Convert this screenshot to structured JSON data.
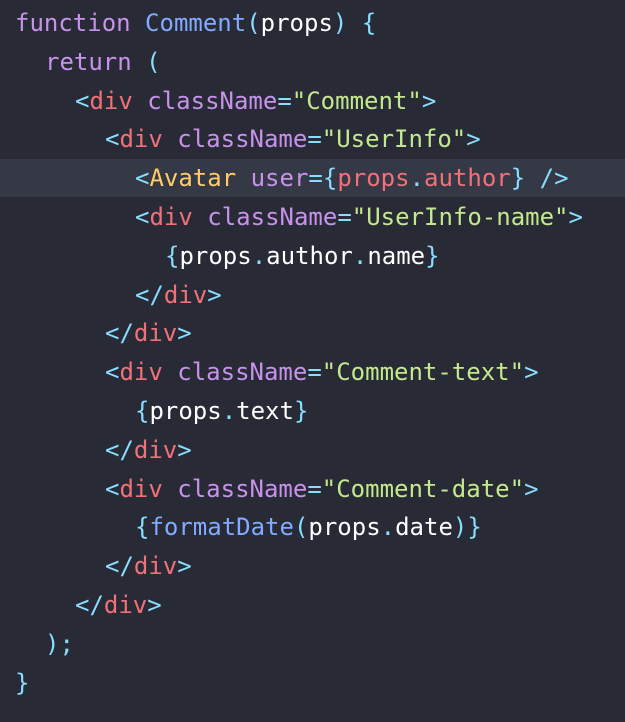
{
  "colors": {
    "background": "#282a36",
    "highlight_line": "#353845",
    "keyword": "#c792ea",
    "function": "#82aaff",
    "punct": "#89ddff",
    "tag": "#f07178",
    "attr": "#c792ea",
    "string": "#c3e88d",
    "component": "#ffcb6b",
    "identifier": "#ffffff",
    "property": "#eeffff"
  },
  "code": {
    "lines": [
      {
        "indent": 0,
        "highlight": false,
        "tokens": [
          {
            "text": "function",
            "kind": "keyword"
          },
          {
            "text": " ",
            "kind": "identifier"
          },
          {
            "text": "Comment",
            "kind": "function"
          },
          {
            "text": "(",
            "kind": "punct"
          },
          {
            "text": "props",
            "kind": "identifier"
          },
          {
            "text": ")",
            "kind": "punct"
          },
          {
            "text": " ",
            "kind": "identifier"
          },
          {
            "text": "{",
            "kind": "punct"
          }
        ]
      },
      {
        "indent": 1,
        "highlight": false,
        "tokens": [
          {
            "text": "return",
            "kind": "keyword"
          },
          {
            "text": " ",
            "kind": "identifier"
          },
          {
            "text": "(",
            "kind": "punct"
          }
        ]
      },
      {
        "indent": 2,
        "highlight": false,
        "tokens": [
          {
            "text": "<",
            "kind": "punct"
          },
          {
            "text": "div",
            "kind": "tag"
          },
          {
            "text": " ",
            "kind": "identifier"
          },
          {
            "text": "className",
            "kind": "attr"
          },
          {
            "text": "=",
            "kind": "punct"
          },
          {
            "text": "\"Comment\"",
            "kind": "string"
          },
          {
            "text": ">",
            "kind": "punct"
          }
        ]
      },
      {
        "indent": 3,
        "highlight": false,
        "tokens": [
          {
            "text": "<",
            "kind": "punct"
          },
          {
            "text": "div",
            "kind": "tag"
          },
          {
            "text": " ",
            "kind": "identifier"
          },
          {
            "text": "className",
            "kind": "attr"
          },
          {
            "text": "=",
            "kind": "punct"
          },
          {
            "text": "\"UserInfo\"",
            "kind": "string"
          },
          {
            "text": ">",
            "kind": "punct"
          }
        ]
      },
      {
        "indent": 4,
        "highlight": true,
        "tokens": [
          {
            "text": "<",
            "kind": "punct"
          },
          {
            "text": "Avatar",
            "kind": "component"
          },
          {
            "text": " ",
            "kind": "identifier"
          },
          {
            "text": "user",
            "kind": "attr"
          },
          {
            "text": "=",
            "kind": "punct"
          },
          {
            "text": "{",
            "kind": "punct"
          },
          {
            "text": "props",
            "kind": "tag"
          },
          {
            "text": ".",
            "kind": "punct"
          },
          {
            "text": "author",
            "kind": "tag"
          },
          {
            "text": "}",
            "kind": "punct"
          },
          {
            "text": " ",
            "kind": "identifier"
          },
          {
            "text": "/>",
            "kind": "punct"
          }
        ]
      },
      {
        "indent": 4,
        "highlight": false,
        "tokens": [
          {
            "text": "<",
            "kind": "punct"
          },
          {
            "text": "div",
            "kind": "tag"
          },
          {
            "text": " ",
            "kind": "identifier"
          },
          {
            "text": "className",
            "kind": "attr"
          },
          {
            "text": "=",
            "kind": "punct"
          },
          {
            "text": "\"UserInfo-name\"",
            "kind": "string"
          },
          {
            "text": ">",
            "kind": "punct"
          }
        ]
      },
      {
        "indent": 5,
        "highlight": false,
        "tokens": [
          {
            "text": "{",
            "kind": "punct"
          },
          {
            "text": "props",
            "kind": "identifier"
          },
          {
            "text": ".",
            "kind": "punct"
          },
          {
            "text": "author",
            "kind": "identifier"
          },
          {
            "text": ".",
            "kind": "punct"
          },
          {
            "text": "name",
            "kind": "identifier"
          },
          {
            "text": "}",
            "kind": "punct"
          }
        ]
      },
      {
        "indent": 4,
        "highlight": false,
        "tokens": [
          {
            "text": "</",
            "kind": "punct"
          },
          {
            "text": "div",
            "kind": "tag"
          },
          {
            "text": ">",
            "kind": "punct"
          }
        ]
      },
      {
        "indent": 3,
        "highlight": false,
        "tokens": [
          {
            "text": "</",
            "kind": "punct"
          },
          {
            "text": "div",
            "kind": "tag"
          },
          {
            "text": ">",
            "kind": "punct"
          }
        ]
      },
      {
        "indent": 3,
        "highlight": false,
        "tokens": [
          {
            "text": "<",
            "kind": "punct"
          },
          {
            "text": "div",
            "kind": "tag"
          },
          {
            "text": " ",
            "kind": "identifier"
          },
          {
            "text": "className",
            "kind": "attr"
          },
          {
            "text": "=",
            "kind": "punct"
          },
          {
            "text": "\"Comment-text\"",
            "kind": "string"
          },
          {
            "text": ">",
            "kind": "punct"
          }
        ]
      },
      {
        "indent": 4,
        "highlight": false,
        "tokens": [
          {
            "text": "{",
            "kind": "punct"
          },
          {
            "text": "props",
            "kind": "identifier"
          },
          {
            "text": ".",
            "kind": "punct"
          },
          {
            "text": "text",
            "kind": "identifier"
          },
          {
            "text": "}",
            "kind": "punct"
          }
        ]
      },
      {
        "indent": 3,
        "highlight": false,
        "tokens": [
          {
            "text": "</",
            "kind": "punct"
          },
          {
            "text": "div",
            "kind": "tag"
          },
          {
            "text": ">",
            "kind": "punct"
          }
        ]
      },
      {
        "indent": 3,
        "highlight": false,
        "tokens": [
          {
            "text": "<",
            "kind": "punct"
          },
          {
            "text": "div",
            "kind": "tag"
          },
          {
            "text": " ",
            "kind": "identifier"
          },
          {
            "text": "className",
            "kind": "attr"
          },
          {
            "text": "=",
            "kind": "punct"
          },
          {
            "text": "\"Comment-date\"",
            "kind": "string"
          },
          {
            "text": ">",
            "kind": "punct"
          }
        ]
      },
      {
        "indent": 4,
        "highlight": false,
        "tokens": [
          {
            "text": "{",
            "kind": "punct"
          },
          {
            "text": "formatDate",
            "kind": "function"
          },
          {
            "text": "(",
            "kind": "punct"
          },
          {
            "text": "props",
            "kind": "identifier"
          },
          {
            "text": ".",
            "kind": "punct"
          },
          {
            "text": "date",
            "kind": "identifier"
          },
          {
            "text": ")",
            "kind": "punct"
          },
          {
            "text": "}",
            "kind": "punct"
          }
        ]
      },
      {
        "indent": 3,
        "highlight": false,
        "tokens": [
          {
            "text": "</",
            "kind": "punct"
          },
          {
            "text": "div",
            "kind": "tag"
          },
          {
            "text": ">",
            "kind": "punct"
          }
        ]
      },
      {
        "indent": 2,
        "highlight": false,
        "tokens": [
          {
            "text": "</",
            "kind": "punct"
          },
          {
            "text": "div",
            "kind": "tag"
          },
          {
            "text": ">",
            "kind": "punct"
          }
        ]
      },
      {
        "indent": 1,
        "highlight": false,
        "tokens": [
          {
            "text": ")",
            "kind": "punct"
          },
          {
            "text": ";",
            "kind": "punct"
          }
        ]
      },
      {
        "indent": 0,
        "highlight": false,
        "tokens": [
          {
            "text": "}",
            "kind": "punct"
          }
        ]
      }
    ]
  }
}
